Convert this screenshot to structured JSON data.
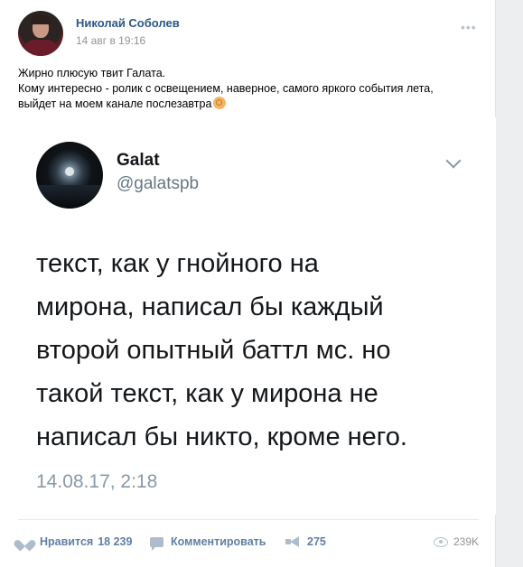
{
  "post": {
    "author": "Николай Соболев",
    "date": "14 авг в 19:16",
    "more_label": "•••",
    "text_lines": [
      "Жирно плюсую твит Галата.",
      "Кому интересно - ролик с освещением, наверное, самого яркого события лета,",
      "выйдет на моем канале послезавтра"
    ],
    "emoji": "ok-hand-emoji"
  },
  "tweet": {
    "name": "Galat",
    "handle": "@galatspb",
    "text_lines": [
      "текст, как у гнойного на",
      "мирона, написал бы каждый",
      "второй опытный баттл мс. но",
      "такой текст, как у мирона не",
      "написал бы никто, кроме него."
    ],
    "timestamp": "14.08.17, 2:18"
  },
  "actions": {
    "like_label": "Нравится",
    "like_count": "18 239",
    "comment_label": "Комментировать",
    "share_count": "275",
    "views": "239K"
  },
  "colors": {
    "link": "#2a5885",
    "action": "#5e7fa3",
    "background": "#edeef0"
  }
}
